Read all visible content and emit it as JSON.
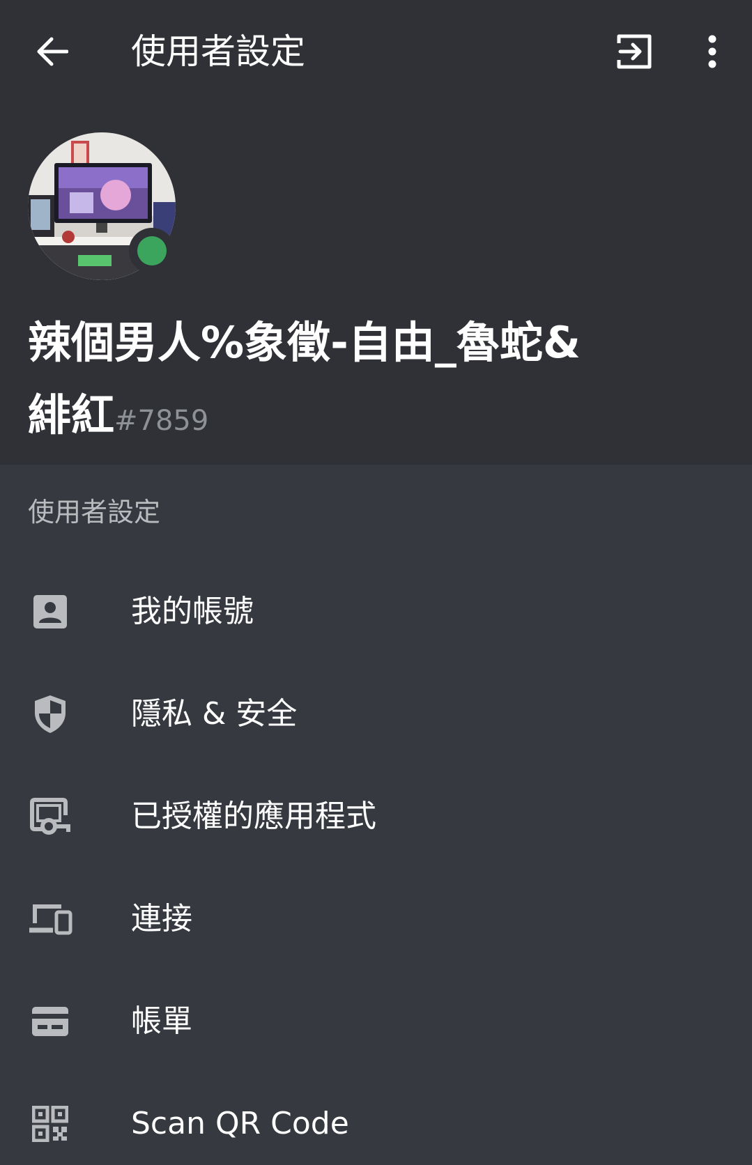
{
  "topbar": {
    "title": "使用者設定",
    "back_icon": "arrow-left-icon",
    "logout_icon": "logout-icon",
    "more_icon": "more-vertical-icon"
  },
  "profile": {
    "name_line1": "辣個男人%象徵-自由_魯蛇&",
    "name_line2": "緋紅",
    "discriminator": "#7859",
    "status": "online",
    "status_color": "#3ba55d"
  },
  "section": {
    "title": "使用者設定",
    "items": [
      {
        "label": "我的帳號",
        "icon": "account-icon"
      },
      {
        "label": "隱私 & 安全",
        "icon": "shield-icon"
      },
      {
        "label": "已授權的應用程式",
        "icon": "authorized-apps-icon"
      },
      {
        "label": "連接",
        "icon": "devices-icon"
      },
      {
        "label": "帳單",
        "icon": "credit-card-icon"
      },
      {
        "label": "Scan QR Code",
        "icon": "qr-code-icon"
      }
    ]
  },
  "colors": {
    "header_bg": "#2f3136",
    "body_bg": "#36393f",
    "icon": "#b9bbbe",
    "text": "#ffffff",
    "muted": "#8e9297"
  }
}
